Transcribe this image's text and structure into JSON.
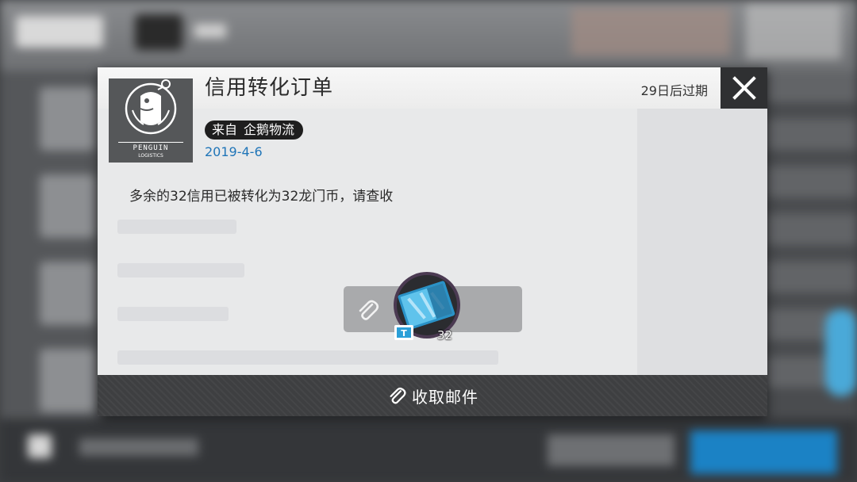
{
  "mail": {
    "title": "信用转化订单",
    "expire": "29日后过期",
    "sender_prefix": "来自",
    "sender": "企鹅物流",
    "date": "2019-4-6",
    "body": "多余的32信用已被转化为32龙门币，请查收",
    "logo_text_1": "PENGUIN",
    "logo_text_2": "LOGISTICS"
  },
  "attachment": {
    "item_name": "龙门币",
    "quantity": "32"
  },
  "footer": {
    "collect_label": "收取邮件"
  },
  "icons": {
    "close": "close-icon",
    "paperclip": "paperclip-icon",
    "ticket": "ticket-icon"
  },
  "colors": {
    "accent_blue": "#1f75b8",
    "close_bg": "#2f3032",
    "footer_bg": "#3e3f41"
  }
}
